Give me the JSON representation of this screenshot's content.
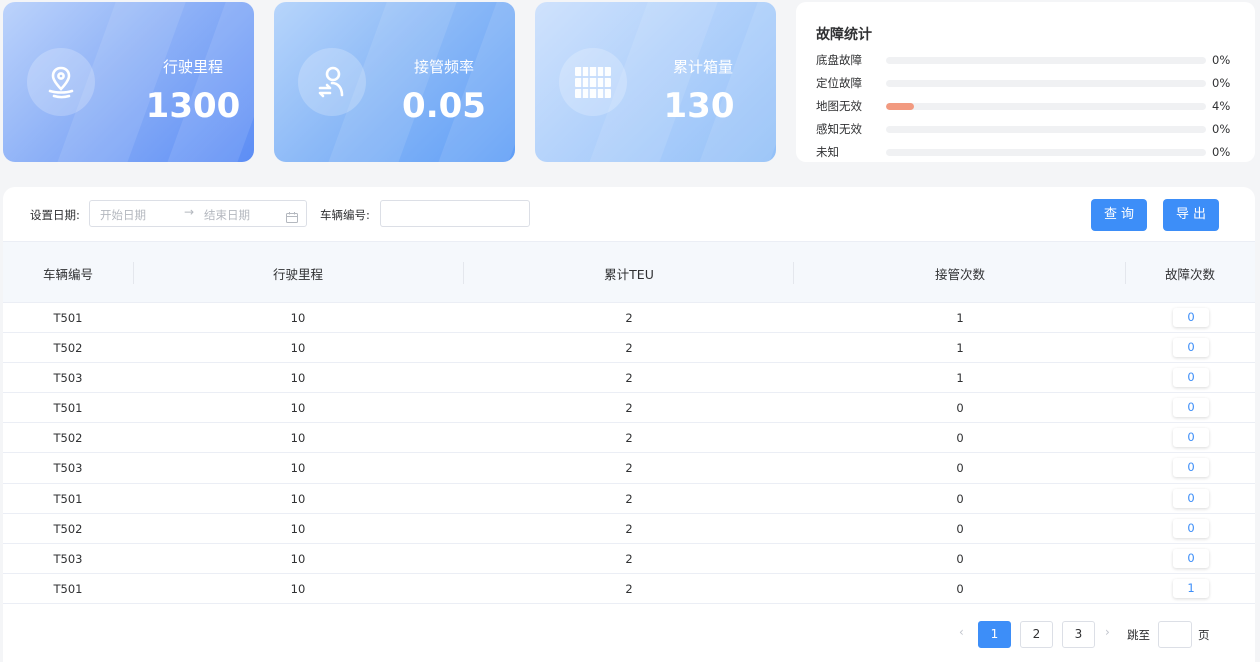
{
  "stat_cards": [
    {
      "label": "行驶里程",
      "value": "1300",
      "icon": "location-road-icon"
    },
    {
      "label": "接管频率",
      "value": "0.05",
      "icon": "user-swap-icon"
    },
    {
      "label": "累计箱量",
      "value": "130",
      "icon": "container-icon"
    }
  ],
  "fault_stats": {
    "title": "故障统计",
    "items": [
      {
        "name": "底盘故障",
        "percent": "0%",
        "fraction": 0
      },
      {
        "name": "定位故障",
        "percent": "0%",
        "fraction": 0
      },
      {
        "name": "地图无效",
        "percent": "4%",
        "fraction": 0.04
      },
      {
        "name": "感知无效",
        "percent": "0%",
        "fraction": 0
      },
      {
        "name": "未知",
        "percent": "0%",
        "fraction": 0
      }
    ],
    "bar_color": "#f29a80"
  },
  "filters": {
    "date_label": "设置日期:",
    "start_placeholder": "开始日期",
    "range_separator": "→",
    "end_placeholder": "结束日期",
    "vehicle_label": "车辆编号:",
    "vehicle_value": ""
  },
  "buttons": {
    "query": "查询",
    "export": "导出"
  },
  "table": {
    "headers": [
      "车辆编号",
      "行驶里程",
      "累计TEU",
      "接管次数",
      "故障次数"
    ],
    "rows": [
      [
        "T501",
        "10",
        "2",
        "1",
        "0"
      ],
      [
        "T502",
        "10",
        "2",
        "1",
        "0"
      ],
      [
        "T503",
        "10",
        "2",
        "1",
        "0"
      ],
      [
        "T501",
        "10",
        "2",
        "0",
        "0"
      ],
      [
        "T502",
        "10",
        "2",
        "0",
        "0"
      ],
      [
        "T503",
        "10",
        "2",
        "0",
        "0"
      ],
      [
        "T501",
        "10",
        "2",
        "0",
        "0"
      ],
      [
        "T502",
        "10",
        "2",
        "0",
        "0"
      ],
      [
        "T503",
        "10",
        "2",
        "0",
        "0"
      ],
      [
        "T501",
        "10",
        "2",
        "0",
        "1"
      ]
    ]
  },
  "pagination": {
    "prev": "‹",
    "pages": [
      "1",
      "2",
      "3"
    ],
    "active_page": "1",
    "next": "›",
    "jump_label": "跳至",
    "page_suffix": "页"
  },
  "colors": {
    "accent": "#3d8ef8"
  }
}
